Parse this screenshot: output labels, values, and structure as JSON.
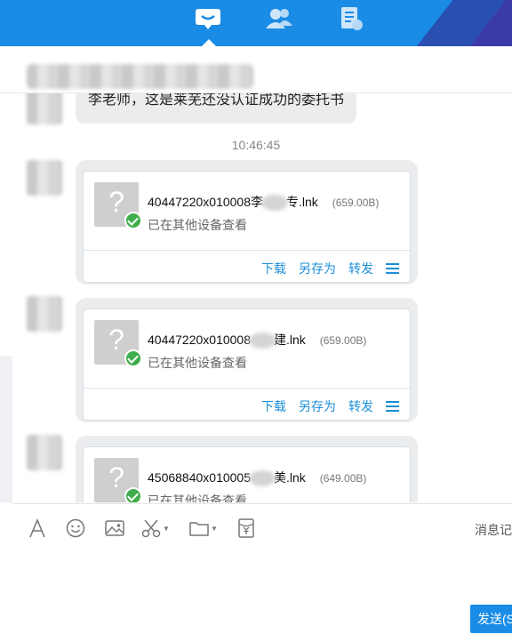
{
  "nav": {
    "tabs": [
      {
        "icon": "chat-bubble-icon",
        "active": true
      },
      {
        "icon": "contacts-icon",
        "active": false
      },
      {
        "icon": "documents-icon",
        "active": false
      }
    ]
  },
  "messages": {
    "text_message": "李老师，这是莱芜还没认证成功的委托书",
    "timestamp": "10:46:45",
    "files": [
      {
        "name_prefix": "40447220x010008李",
        "name_suffix": "专.lnk",
        "size": "(659.00B)",
        "status": "已在其他设备查看",
        "actions": {
          "download": "下载",
          "save_as": "另存为",
          "forward": "转发"
        }
      },
      {
        "name_prefix": "40447220x010008",
        "name_suffix": "建.lnk",
        "size": "(659.00B)",
        "status": "已在其他设备查看",
        "actions": {
          "download": "下载",
          "save_as": "另存为",
          "forward": "转发"
        }
      },
      {
        "name_prefix": "45068840x010005",
        "name_suffix": "美.lnk",
        "size": "(649.00B)",
        "status": "已在其他设备查看"
      }
    ]
  },
  "editor": {
    "history_label": "消息记",
    "send_label": "发送(S"
  },
  "colors": {
    "accent": "#1a8ce6",
    "link": "#1b8fd6",
    "success": "#3fad4b"
  }
}
